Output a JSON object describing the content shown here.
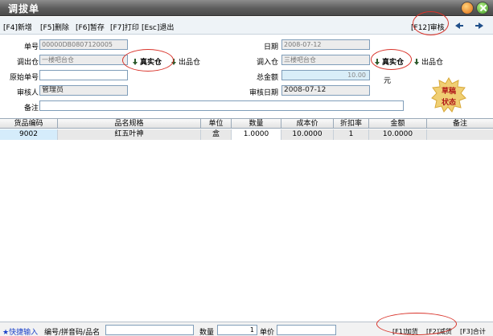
{
  "window": {
    "title": "调拔单"
  },
  "toolbar": {
    "new": "[F4]新增",
    "delete": "[F5]删除",
    "hold": "[F6]暂存",
    "print": "[F7]打印",
    "exit": "[Esc]退出",
    "audit": "[F12]审核"
  },
  "form": {
    "doc_no": {
      "label": "单号",
      "value": "00000DB0807120005"
    },
    "date": {
      "label": "日期",
      "value": "2008-07-12"
    },
    "out_wh": {
      "label": "调出仓",
      "value": "一楼吧台仓"
    },
    "in_wh": {
      "label": "调入仓",
      "value": "三楼吧台仓"
    },
    "wh_option_real": "真实仓",
    "wh_option_output": "出品仓",
    "orig_no": {
      "label": "原始单号",
      "value": ""
    },
    "total": {
      "label": "总金额",
      "value": "10.00",
      "unit": "元"
    },
    "auditor": {
      "label": "审核人",
      "value": "管理员"
    },
    "audit_date": {
      "label": "审核日期",
      "value": "2008-07-12"
    },
    "remark": {
      "label": "备注",
      "value": ""
    }
  },
  "stamp": {
    "line1": "草稿",
    "line2": "状态"
  },
  "grid": {
    "headers": [
      "货品编码",
      "品名规格",
      "单位",
      "数量",
      "成本价",
      "折扣率",
      "金额",
      "备注"
    ],
    "rows": [
      [
        "9002",
        "红五叶神",
        "盒",
        "1.0000",
        "10.0000",
        "1",
        "10.0000",
        ""
      ]
    ]
  },
  "bottom": {
    "quick_input": "★快捷输入",
    "code_label": "编号/拼音码/品名",
    "code_value": "",
    "qty_label": "数量",
    "qty_value": "1",
    "price_label": "单价",
    "price_value": "",
    "add": "[F1]加货",
    "reduce": "[F2]减货",
    "sum": "[F3]合计"
  },
  "colors": {
    "annotation": "#d9332a",
    "stamp": "#b01818",
    "title_bar": "#5c5c5c"
  }
}
